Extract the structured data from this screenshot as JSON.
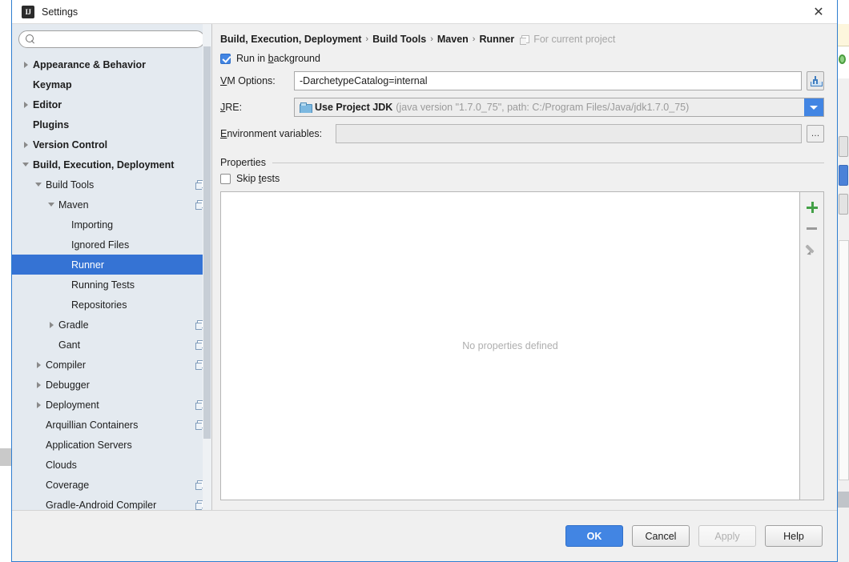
{
  "window": {
    "title": "Settings",
    "app_icon": "IJ",
    "close_label": "✕"
  },
  "search": {
    "placeholder": "",
    "value": "",
    "icon": "search-icon"
  },
  "tree": {
    "items": [
      {
        "label": "Appearance & Behavior",
        "indent": 0,
        "arrow": "right",
        "bold": true,
        "selected": false,
        "project_icon": false
      },
      {
        "label": "Keymap",
        "indent": 0,
        "arrow": "none",
        "bold": true,
        "selected": false,
        "project_icon": false
      },
      {
        "label": "Editor",
        "indent": 0,
        "arrow": "right",
        "bold": true,
        "selected": false,
        "project_icon": false
      },
      {
        "label": "Plugins",
        "indent": 0,
        "arrow": "none",
        "bold": true,
        "selected": false,
        "project_icon": false
      },
      {
        "label": "Version Control",
        "indent": 0,
        "arrow": "right",
        "bold": true,
        "selected": false,
        "project_icon": false
      },
      {
        "label": "Build, Execution, Deployment",
        "indent": 0,
        "arrow": "down",
        "bold": true,
        "selected": false,
        "project_icon": false
      },
      {
        "label": "Build Tools",
        "indent": 1,
        "arrow": "down",
        "bold": false,
        "selected": false,
        "project_icon": true
      },
      {
        "label": "Maven",
        "indent": 2,
        "arrow": "down",
        "bold": false,
        "selected": false,
        "project_icon": true
      },
      {
        "label": "Importing",
        "indent": 3,
        "arrow": "none",
        "bold": false,
        "selected": false,
        "project_icon": false
      },
      {
        "label": "Ignored Files",
        "indent": 3,
        "arrow": "none",
        "bold": false,
        "selected": false,
        "project_icon": false
      },
      {
        "label": "Runner",
        "indent": 3,
        "arrow": "none",
        "bold": false,
        "selected": true,
        "project_icon": false
      },
      {
        "label": "Running Tests",
        "indent": 3,
        "arrow": "none",
        "bold": false,
        "selected": false,
        "project_icon": false
      },
      {
        "label": "Repositories",
        "indent": 3,
        "arrow": "none",
        "bold": false,
        "selected": false,
        "project_icon": false
      },
      {
        "label": "Gradle",
        "indent": 2,
        "arrow": "right",
        "bold": false,
        "selected": false,
        "project_icon": true
      },
      {
        "label": "Gant",
        "indent": 2,
        "arrow": "none",
        "bold": false,
        "selected": false,
        "project_icon": true
      },
      {
        "label": "Compiler",
        "indent": 1,
        "arrow": "right",
        "bold": false,
        "selected": false,
        "project_icon": true
      },
      {
        "label": "Debugger",
        "indent": 1,
        "arrow": "right",
        "bold": false,
        "selected": false,
        "project_icon": false
      },
      {
        "label": "Deployment",
        "indent": 1,
        "arrow": "right",
        "bold": false,
        "selected": false,
        "project_icon": true
      },
      {
        "label": "Arquillian Containers",
        "indent": 1,
        "arrow": "none",
        "bold": false,
        "selected": false,
        "project_icon": true
      },
      {
        "label": "Application Servers",
        "indent": 1,
        "arrow": "none",
        "bold": false,
        "selected": false,
        "project_icon": false
      },
      {
        "label": "Clouds",
        "indent": 1,
        "arrow": "none",
        "bold": false,
        "selected": false,
        "project_icon": false
      },
      {
        "label": "Coverage",
        "indent": 1,
        "arrow": "none",
        "bold": false,
        "selected": false,
        "project_icon": true
      },
      {
        "label": "Gradle-Android Compiler",
        "indent": 1,
        "arrow": "none",
        "bold": false,
        "selected": false,
        "project_icon": true
      }
    ]
  },
  "breadcrumb": {
    "crumbs": [
      "Build, Execution, Deployment",
      "Build Tools",
      "Maven",
      "Runner"
    ],
    "separator": "›",
    "suffix": "For current project",
    "suffix_icon": "project-scope-icon"
  },
  "form": {
    "run_in_background": {
      "label_prefix": "Run in ",
      "label_mnemonic": "b",
      "label_suffix": "ackground",
      "checked": true
    },
    "vm_options": {
      "label_mnemonic": "V",
      "label_rest": "M Options:",
      "value": "-DarchetypeCatalog=internal",
      "button_icon": "insert-macro-icon"
    },
    "jre": {
      "label_mnemonic": "J",
      "label_rest": "RE:",
      "icon": "jdk-folder-icon",
      "value_main": "Use Project JDK",
      "value_detail": "(java version \"1.7.0_75\", path: C:/Program Files/Java/jdk1.7.0_75)",
      "dropdown_icon": "chevron-down-icon"
    },
    "environment_variables": {
      "label_mnemonic": "E",
      "label_rest": "nvironment variables:",
      "value": "",
      "browse_label": "…"
    }
  },
  "properties": {
    "section_title": "Properties",
    "skip_tests": {
      "label_prefix": "Skip ",
      "label_mnemonic": "t",
      "label_suffix": "ests",
      "checked": false
    },
    "empty_text": "No properties defined",
    "toolbar": [
      {
        "name": "add-property-button",
        "icon": "plus-icon"
      },
      {
        "name": "remove-property-button",
        "icon": "minus-icon"
      },
      {
        "name": "edit-property-button",
        "icon": "pencil-icon"
      }
    ]
  },
  "footer": {
    "ok": "OK",
    "cancel": "Cancel",
    "apply": "Apply",
    "apply_disabled": true,
    "help": "Help"
  },
  "colors": {
    "accent": "#4285e3",
    "selection": "#3573d4",
    "sidebar_bg": "#e4eaf0",
    "panel_bg": "#f0f0f0",
    "add_green": "#43a047",
    "muted_text": "#a6a6a6"
  }
}
